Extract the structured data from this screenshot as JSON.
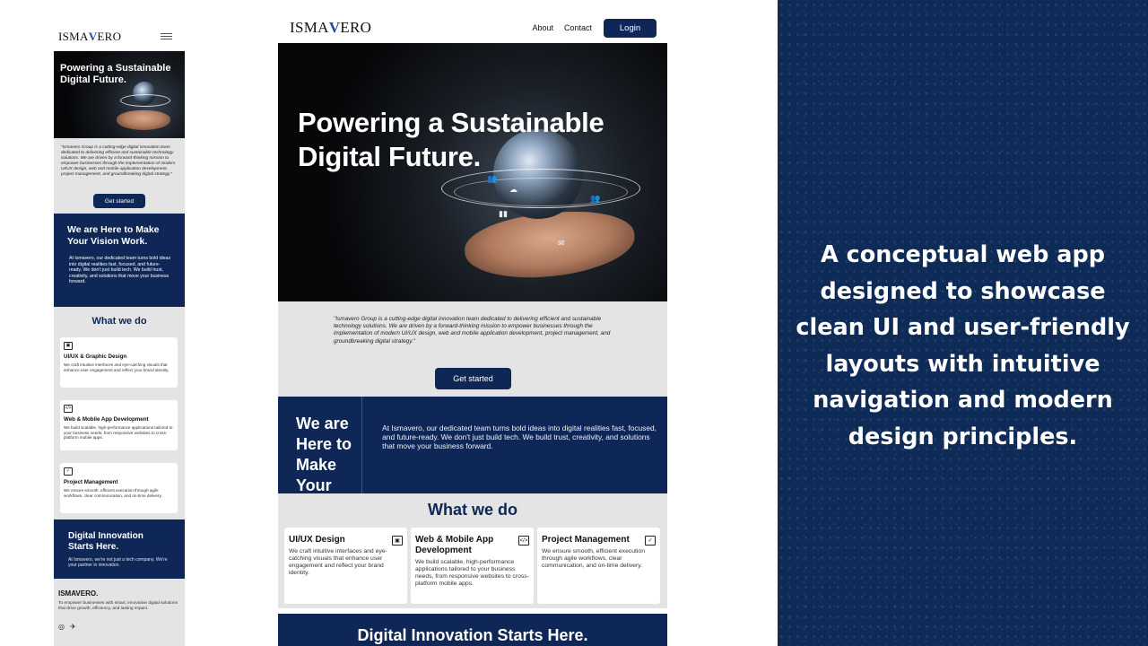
{
  "brand": {
    "logo_prefix": "ISMA",
    "logo_v": "V",
    "logo_suffix": "ERO"
  },
  "mobile": {
    "hero_title": "Powering a Sustainable Digital Future.",
    "about_text": "\"Ismavero Group is a cutting-edge digital innovation team dedicated to delivering efficient and sustainable technology solutions. We are driven by a forward-thinking mission to empower businesses through the implementation of modern UI/UX design, web and mobile application development, project management, and groundbreaking digital strategy.\"",
    "cta_label": "Get started",
    "vision_title": "We are Here to Make Your Vision Work.",
    "vision_text": "At Ismavero, our dedicated team turns bold ideas into digital realities fast, focused, and future-ready. We don't just build tech. We build trust, creativity, and solutions that move your business forward.",
    "services_title": "What we do",
    "services": [
      {
        "title": "UI/UX & Graphic Design",
        "text": "We craft intuitive interfaces and eye-catching visuals that enhance user engagement and reflect your brand identity."
      },
      {
        "title": "Web & Mobile App Development",
        "text": "We build scalable, high-performance applications tailored to your business needs, from responsive websites to cross-platform mobile apps."
      },
      {
        "title": "Project Management",
        "text": "We ensure smooth, efficient execution through agile workflows, clear communication, and on-time delivery."
      }
    ],
    "digital_title": "Digital Innovation Starts Here.",
    "digital_text": "At Ismavero, we're not just a tech company. We're your partner in innovation.",
    "footer_title": "ISMAVERO.",
    "footer_text": "To empower businesses with smart, innovative digital solutions that drive growth, efficiency, and lasting impact."
  },
  "desktop": {
    "nav": {
      "about": "About",
      "contact": "Contact",
      "login": "Login"
    },
    "hero_title": "Powering a Sustainable Digital Future.",
    "about_text": "\"Ismavero Group is a cutting-edge digital innovation team dedicated to delivering efficient and sustainable technology solutions. We are driven by a forward-thinking mission to empower businesses through the implementation of modern UI/UX design, web and mobile application development, project management, and groundbreaking digital strategy.\"",
    "cta_label": "Get started",
    "vision_title": "We are Here to Make Your Vision Work.",
    "vision_text": "At Ismavero, our dedicated team turns bold ideas into digital realities fast, focused, and future-ready. We don't just build tech. We build trust, creativity, and solutions that move your business forward.",
    "services_title": "What we do",
    "services": [
      {
        "title": "UI/UX Design",
        "text": "We craft intuitive interfaces and eye-catching visuals that enhance user engagement and reflect your brand identity."
      },
      {
        "title": "Web & Mobile App Development",
        "text": "We build scalable, high-performance applications tailored to your business needs, from responsive websites to cross-platform mobile apps."
      },
      {
        "title": "Project Management",
        "text": "We ensure smooth, efficient execution through agile workflows, clear communication, and on-time delivery."
      }
    ],
    "digital_title": "Digital Innovation Starts Here."
  },
  "panel": {
    "caption": "A conceptual web app designed to showcase clean UI and user-friendly layouts with intuitive navigation and modern design principles."
  },
  "colors": {
    "navy": "#0f2757",
    "panel_bg": "#0e2a57",
    "section_gray": "#e4e4e4",
    "logo_accent": "#1f4e9a"
  },
  "icons": [
    "hamburger-menu-icon",
    "design-icon",
    "code-icon",
    "clipboard-icon",
    "instagram-icon",
    "twitter-icon"
  ]
}
